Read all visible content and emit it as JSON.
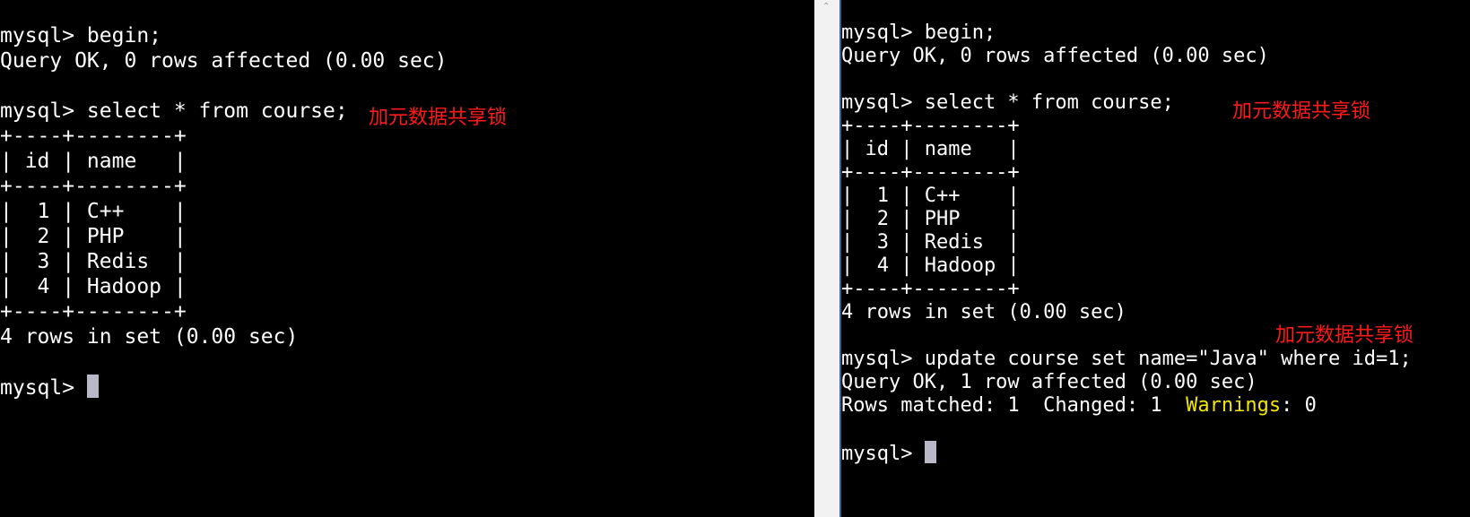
{
  "left_terminal": {
    "lines": [
      "mysql> begin;",
      "Query OK, 0 rows affected (0.00 sec)",
      "",
      "mysql> select * from course;",
      "+----+--------+",
      "| id | name   |",
      "+----+--------+",
      "|  1 | C++    |",
      "|  2 | PHP    |",
      "|  3 | Redis  |",
      "|  4 | Hadoop |",
      "+----+--------+",
      "4 rows in set (0.00 sec)",
      "",
      "mysql> "
    ],
    "annotation": "加元数据共享锁"
  },
  "right_terminal": {
    "lines": [
      "mysql> begin;",
      "Query OK, 0 rows affected (0.00 sec)",
      "",
      "mysql> select * from course;",
      "+----+--------+",
      "| id | name   |",
      "+----+--------+",
      "|  1 | C++    |",
      "|  2 | PHP    |",
      "|  3 | Redis  |",
      "|  4 | Hadoop |",
      "+----+--------+",
      "4 rows in set (0.00 sec)",
      "",
      "mysql> update course set name=\"Java\" where id=1;",
      "Query OK, 1 row affected (0.00 sec)",
      "",
      "",
      "mysql> "
    ],
    "rows_matched_line": {
      "prefix": "Rows matched: 1  Changed: 1  ",
      "warnings_label": "Warnings",
      "suffix": ": 0"
    },
    "annotation_top": "加元数据共享锁",
    "annotation_bottom": "加元数据共享锁"
  },
  "colors": {
    "background": "#000000",
    "text": "#ffffff",
    "annotation": "#ff1a1a",
    "warnings": "#f2e600",
    "cursor": "#b8b8c8",
    "divider": "#f2f2f2"
  },
  "icons": {
    "scroll_up": "scroll-up-arrow-icon"
  }
}
